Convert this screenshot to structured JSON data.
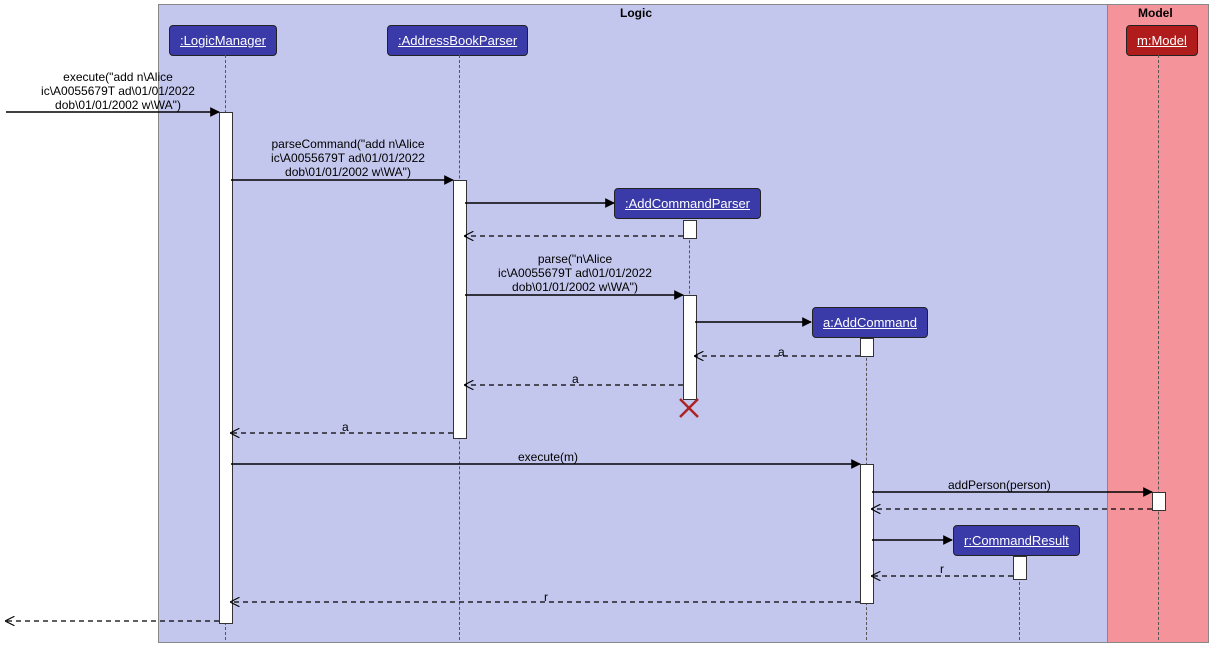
{
  "frame_logic_title": "Logic",
  "frame_model_title": "Model",
  "participants": {
    "logicManager": ":LogicManager",
    "addressBookParser": ":AddressBookParser",
    "addCommandParser": ":AddCommandParser",
    "addCommand": "a:AddCommand",
    "commandResult": "r:CommandResult",
    "model": "m:Model"
  },
  "messages": {
    "m1": "execute(\"add n\\Alice\nic\\A0055679T ad\\01/01/2022\ndob\\01/01/2002 w\\WA\")",
    "m2": "parseCommand(\"add n\\Alice\nic\\A0055679T ad\\01/01/2022\ndob\\01/01/2002 w\\WA\")",
    "m3": "parse(\"n\\Alice\nic\\A0055679T ad\\01/01/2022\ndob\\01/01/2002 w\\WA\")",
    "m4_return_a": "a",
    "m5_return_a": "a",
    "m6_return_a": "a",
    "m7": "execute(m)",
    "m8": "addPerson(person)",
    "m9_return_r": "r",
    "m10_return_r": "r"
  },
  "chart_data": {
    "type": "sequence-diagram",
    "frames": [
      {
        "name": "Logic",
        "participants": [
          ":LogicManager",
          ":AddressBookParser",
          ":AddCommandParser",
          "a:AddCommand",
          "r:CommandResult"
        ]
      },
      {
        "name": "Model",
        "participants": [
          "m:Model"
        ]
      }
    ],
    "messages": [
      {
        "from": "actor",
        "to": ":LogicManager",
        "label": "execute(\"add n\\Alice ic\\A0055679T ad\\01/01/2022 dob\\01/01/2002 w\\WA\")",
        "type": "sync"
      },
      {
        "from": ":LogicManager",
        "to": ":AddressBookParser",
        "label": "parseCommand(\"add n\\Alice ic\\A0055679T ad\\01/01/2022 dob\\01/01/2002 w\\WA\")",
        "type": "sync"
      },
      {
        "from": ":AddressBookParser",
        "to": ":AddCommandParser",
        "label": "create",
        "type": "sync"
      },
      {
        "from": ":AddCommandParser",
        "to": ":AddressBookParser",
        "label": "",
        "type": "return"
      },
      {
        "from": ":AddressBookParser",
        "to": ":AddCommandParser",
        "label": "parse(\"n\\Alice ic\\A0055679T ad\\01/01/2022 dob\\01/01/2002 w\\WA\")",
        "type": "sync"
      },
      {
        "from": ":AddCommandParser",
        "to": "a:AddCommand",
        "label": "create",
        "type": "sync"
      },
      {
        "from": "a:AddCommand",
        "to": ":AddCommandParser",
        "label": "a",
        "type": "return"
      },
      {
        "from": ":AddCommandParser",
        "to": ":AddressBookParser",
        "label": "a",
        "type": "return",
        "end": true
      },
      {
        "from": ":AddressBookParser",
        "to": ":LogicManager",
        "label": "a",
        "type": "return"
      },
      {
        "from": ":LogicManager",
        "to": "a:AddCommand",
        "label": "execute(m)",
        "type": "sync"
      },
      {
        "from": "a:AddCommand",
        "to": "m:Model",
        "label": "addPerson(person)",
        "type": "sync"
      },
      {
        "from": "m:Model",
        "to": "a:AddCommand",
        "label": "",
        "type": "return"
      },
      {
        "from": "a:AddCommand",
        "to": "r:CommandResult",
        "label": "create",
        "type": "sync"
      },
      {
        "from": "r:CommandResult",
        "to": "a:AddCommand",
        "label": "r",
        "type": "return"
      },
      {
        "from": "a:AddCommand",
        "to": ":LogicManager",
        "label": "r",
        "type": "return"
      },
      {
        "from": ":LogicManager",
        "to": "actor",
        "label": "",
        "type": "return"
      }
    ]
  }
}
